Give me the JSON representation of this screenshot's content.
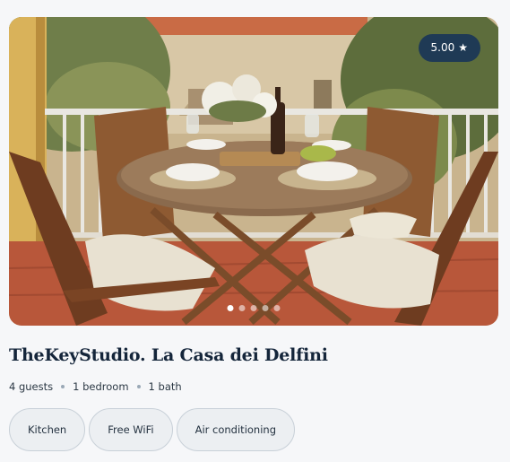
{
  "listing": {
    "rating": "5.00",
    "rating_star": "★",
    "title": "TheKeyStudio. La Casa dei Delfini",
    "meta": {
      "guests": "4 guests",
      "bedrooms": "1 bedroom",
      "baths": "1 bath"
    },
    "amenities": [
      "Kitchen",
      "Free WiFi",
      "Air conditioning"
    ],
    "carousel": {
      "total": 5,
      "active_index": 0
    },
    "photo_description": "Balcony with wooden folding table set for dinner, four chairs with cushions"
  }
}
